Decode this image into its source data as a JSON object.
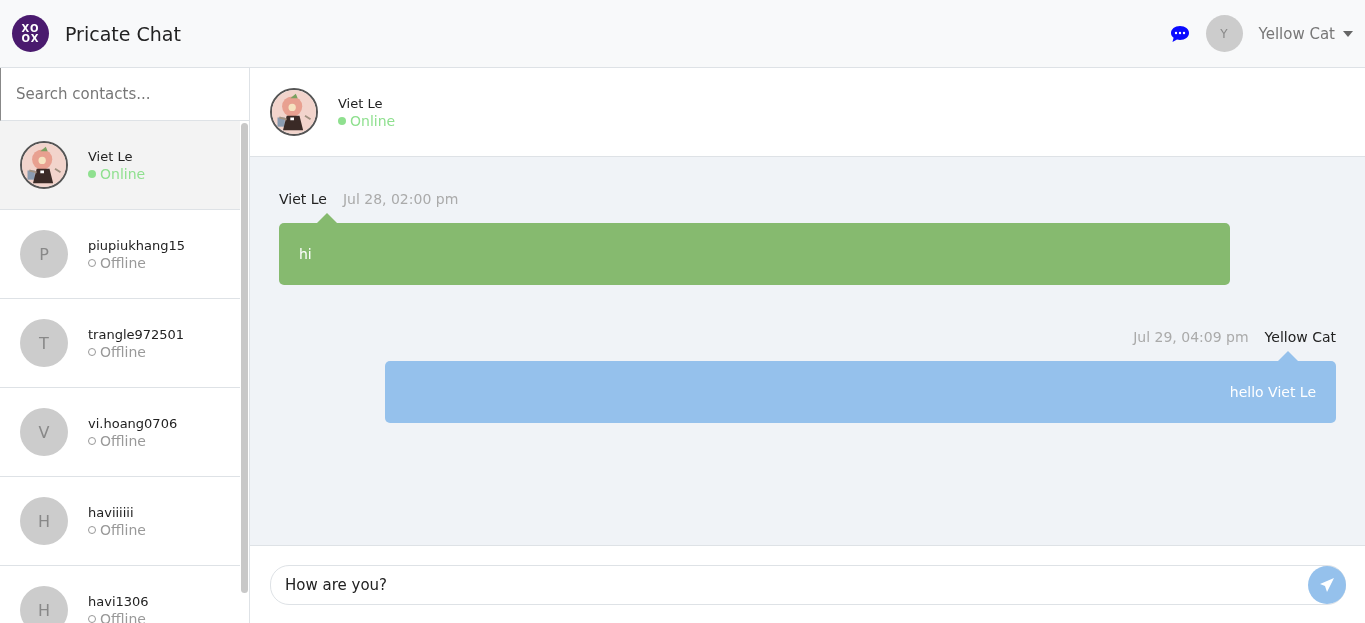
{
  "header": {
    "logo": [
      "XO",
      "OX"
    ],
    "title": "Pricate Chat",
    "user": {
      "initial": "Y",
      "name": "Yellow Cat"
    }
  },
  "search": {
    "placeholder": "Search contacts..."
  },
  "contacts": [
    {
      "name": "Viet Le",
      "online": true,
      "status": "Online",
      "selected": true
    },
    {
      "name": "piupiukhang15",
      "avatar": {
        "kind": "initial",
        "text": "P"
      },
      "online": false,
      "status": "Offline",
      "selected": false
    },
    {
      "name": "trangle972501",
      "avatar": {
        "kind": "initial",
        "text": "T"
      },
      "online": false,
      "status": "Offline",
      "selected": false
    },
    {
      "name": "vi.hoang0706",
      "avatar": {
        "kind": "initial",
        "text": "V"
      },
      "online": false,
      "status": "Offline",
      "selected": false
    },
    {
      "name": "haviiiiii",
      "avatar": {
        "kind": "initial",
        "text": "H"
      },
      "online": false,
      "status": "Offline",
      "selected": false
    },
    {
      "name": "havi1306",
      "avatar": {
        "kind": "initial",
        "text": "H"
      },
      "online": false,
      "status": "Offline",
      "selected": false
    }
  ],
  "chat": {
    "name": "Viet Le",
    "online": true,
    "status": "Online"
  },
  "messages": [
    {
      "kind": "received",
      "sender": "Viet Le",
      "time": "Jul 28, 02:00 pm",
      "text": "hi"
    },
    {
      "kind": "sent",
      "sender": "Yellow Cat",
      "time": "Jul 29, 04:09 pm",
      "text": "hello Viet Le"
    }
  ],
  "composer": {
    "value": "How are you?"
  }
}
